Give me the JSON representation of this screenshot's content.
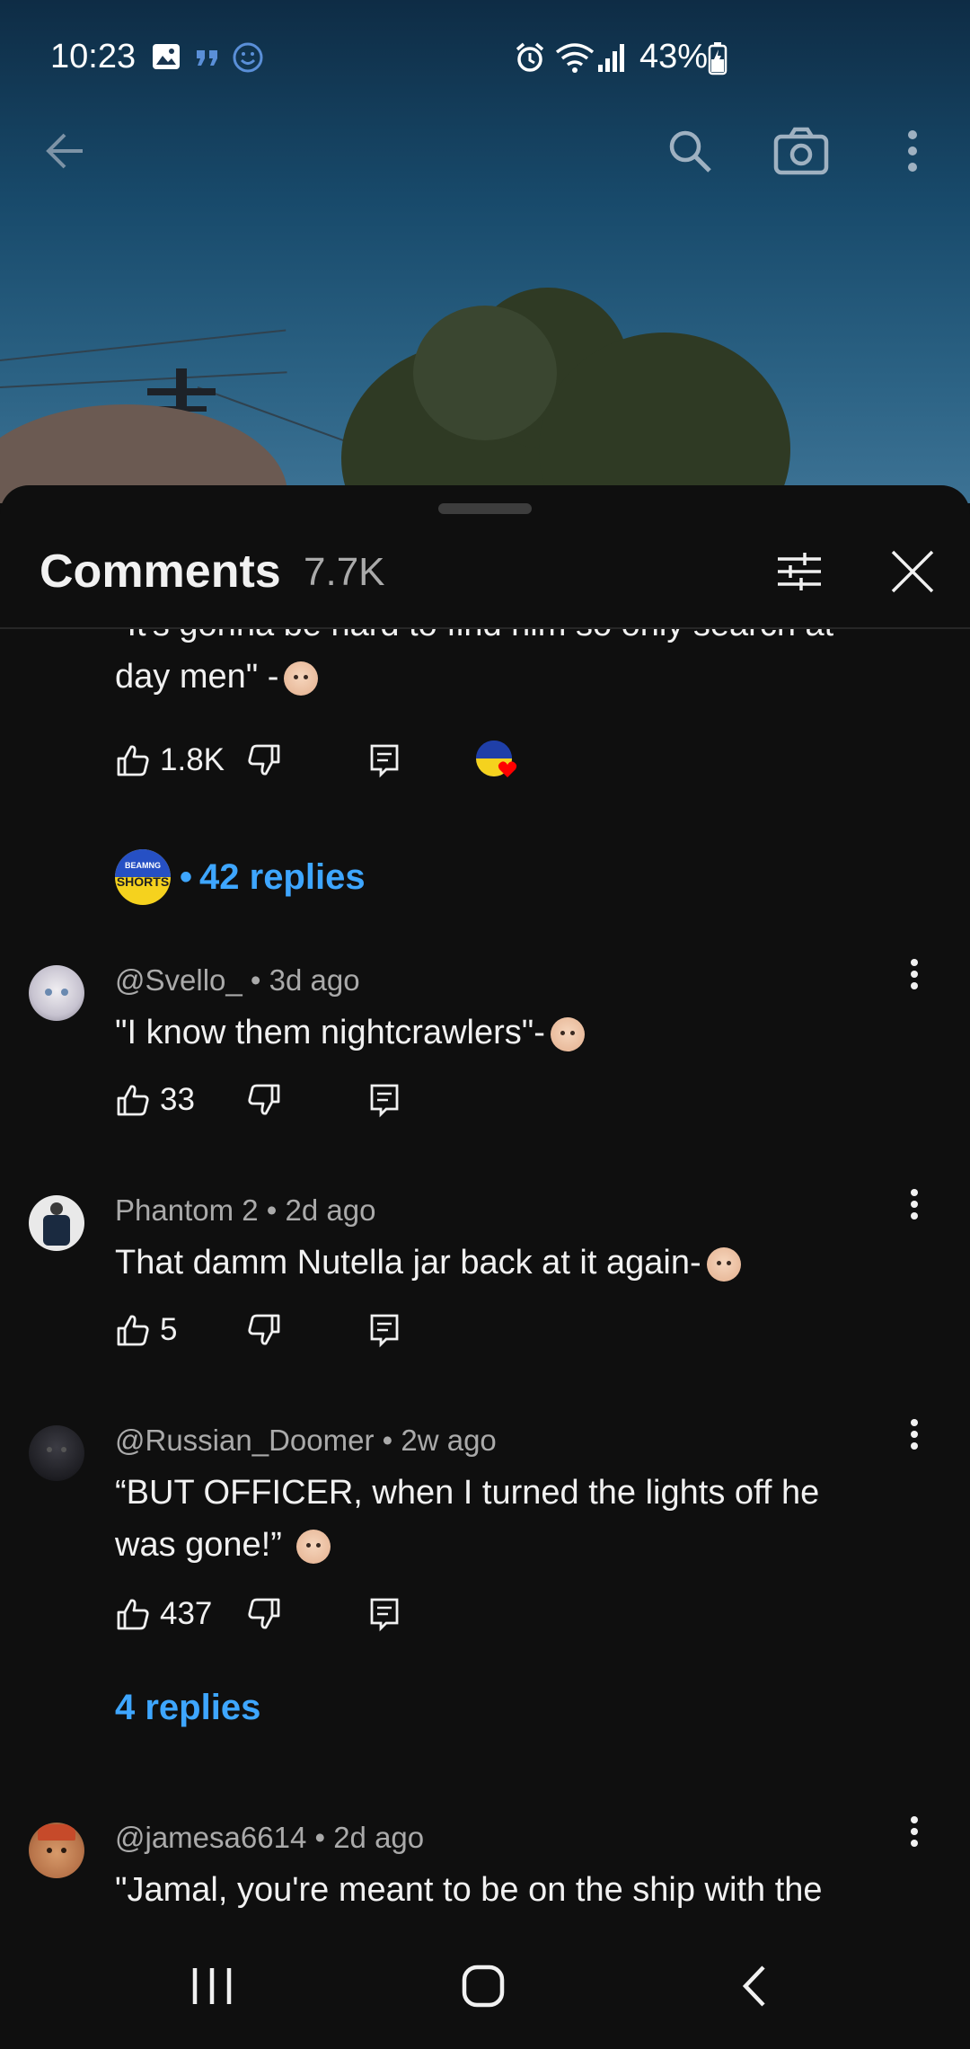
{
  "status_bar": {
    "time": "10:23",
    "battery_percent": "43%",
    "icons": [
      "gallery-icon",
      "quote-icon",
      "smile-icon",
      "alarm-icon",
      "wifi-icon",
      "signal-icon",
      "battery-icon"
    ]
  },
  "top_nav": {
    "icons": [
      "back-arrow-icon",
      "search-icon",
      "camera-icon",
      "more-vert-icon"
    ]
  },
  "comments_panel": {
    "title": "Comments",
    "count": "7.7K",
    "header_icons": [
      "sort-filter-icon",
      "close-icon"
    ],
    "comments": [
      {
        "text_line1": "\"It's gonna be hard to find him so only search at",
        "text_line2": "day men\" -",
        "likes": "1.8K",
        "has_creator_heart": true,
        "replies_label": "42 replies",
        "replies_bullet": "•"
      },
      {
        "author": "@Svello_",
        "age": "3d ago",
        "text": "\"I know them nightcrawlers\"-",
        "likes": "33"
      },
      {
        "author": "Phantom 2",
        "age": "2d ago",
        "text": "That damm Nutella jar back at it again-",
        "likes": "5"
      },
      {
        "author": "@Russian_Doomer",
        "age": "2w ago",
        "text_line1": "“BUT OFFICER, when I turned the lights off he",
        "text_line2": "was gone!”",
        "likes": "437",
        "replies_label": "4 replies"
      },
      {
        "author": "@jamesa6614",
        "age": "2d ago",
        "text_line1": "\"Jamal, you're meant to be on the ship with the"
      }
    ]
  },
  "creator_badge": {
    "line1": "BEAMNG",
    "line2": "SHORTS"
  },
  "meta_separator": "•",
  "nav_bar": {
    "icons": [
      "recent-apps-icon",
      "home-icon",
      "back-icon"
    ]
  },
  "colors": {
    "background": "#0f0f0f",
    "text": "#f1f1f1",
    "secondary_text": "#aaaaaa",
    "link_blue": "#3ea6ff",
    "heart_red": "#ff0000"
  }
}
